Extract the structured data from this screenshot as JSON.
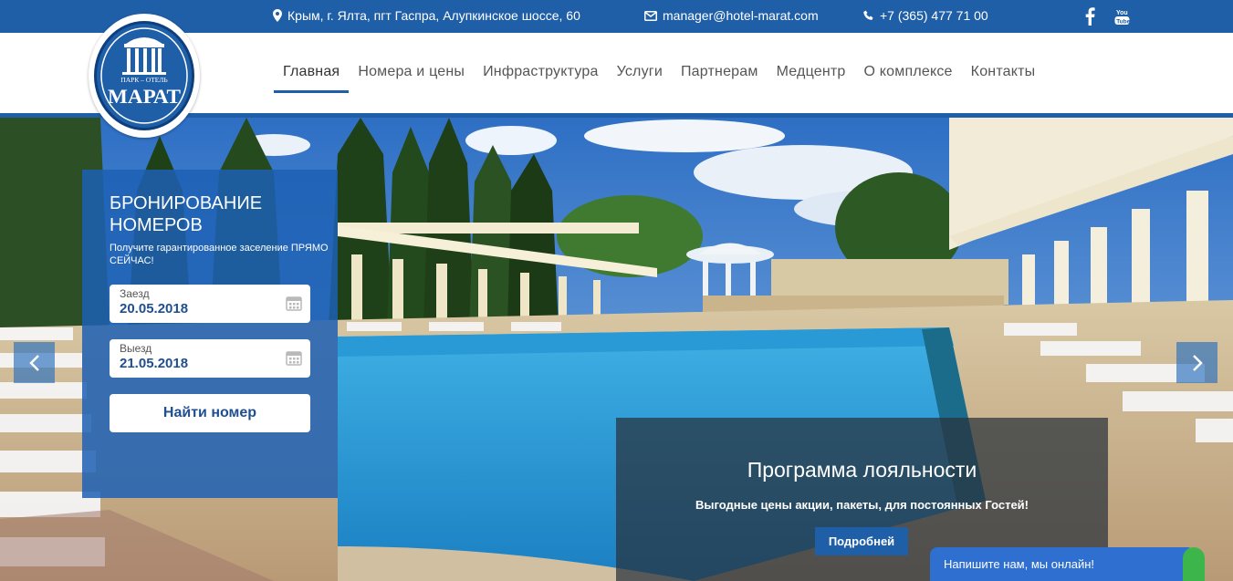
{
  "topbar": {
    "address": "Крым, г. Ялта, пгт Гаспра, Алупкинское шоссе, 60",
    "email": "manager@hotel-marat.com",
    "phone": "+7 (365) 477 71 00",
    "icons": [
      "map-marker-icon",
      "envelope-icon",
      "phone-icon",
      "facebook-icon",
      "youtube-icon"
    ]
  },
  "logo": {
    "top_text": "ПАРК – ОТЕЛЬ",
    "name": "МАРАТ"
  },
  "nav": {
    "items": [
      {
        "label": "Главная",
        "active": true
      },
      {
        "label": "Номера и цены"
      },
      {
        "label": "Инфраструктура"
      },
      {
        "label": "Услуги"
      },
      {
        "label": "Партнерам"
      },
      {
        "label": "Медцентр"
      },
      {
        "label": "О комплексе"
      },
      {
        "label": "Контакты"
      }
    ]
  },
  "booking": {
    "title": "БРОНИРОВАНИЕ НОМЕРОВ",
    "subtitle": "Получите гарантированное заселение ПРЯМО СЕЙЧАС!",
    "checkin_label": "Заезд",
    "checkin_value": "20.05.2018",
    "checkout_label": "Выезд",
    "checkout_value": "21.05.2018",
    "button": "Найти номер"
  },
  "slider": {
    "prev_icon": "chevron-left-icon",
    "next_icon": "chevron-right-icon"
  },
  "loyalty": {
    "title": "Программа лояльности",
    "description": "Выгодные цены акции, пакеты, для постоянных Гостей!",
    "button": "Подробней"
  },
  "chat": {
    "label": "Напишите нам, мы онлайн!"
  },
  "colors": {
    "brand": "#1f5fa8",
    "nav_text": "#555555",
    "loyalty_bg": "#283238",
    "chat": "#2f6fd0",
    "chat_status": "#3cb54a"
  }
}
